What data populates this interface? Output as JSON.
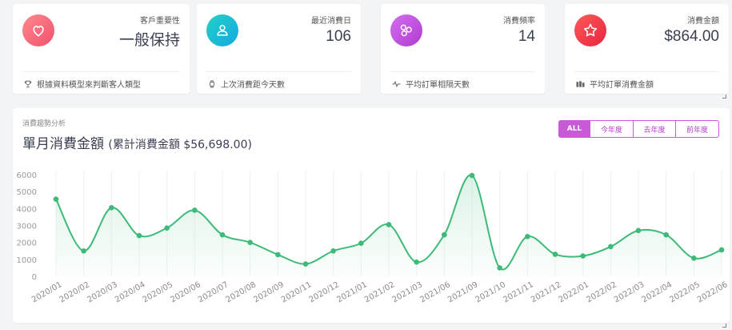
{
  "stats": [
    {
      "label": "客戶重要性",
      "value": "一般保持",
      "footer": "根據資料模型來判斷客人類型",
      "icon": "heart-icon",
      "footer_icon": "trophy-icon",
      "gradient": [
        "#ff8a8a",
        "#f0506e"
      ]
    },
    {
      "label": "最近消費日",
      "value": "106",
      "footer": "上次消費距今天數",
      "icon": "user-icon",
      "footer_icon": "watch-icon",
      "gradient": [
        "#1fd2c5",
        "#17a8e3"
      ]
    },
    {
      "label": "消費頻率",
      "value": "14",
      "footer": "平均訂單相隔天數",
      "icon": "molecule-icon",
      "footer_icon": "pulse-icon",
      "gradient": [
        "#d36ef0",
        "#b03ccf"
      ]
    },
    {
      "label": "消費金額",
      "value": "$864.00",
      "footer": "平均訂單消費金額",
      "icon": "star-icon",
      "footer_icon": "money-icon",
      "gradient": [
        "#ff5a5a",
        "#e8243f"
      ]
    }
  ],
  "chart_section": {
    "subtitle": "消費趨勢分析",
    "title": "單月消費金額",
    "total": "(累計消費金額 $56,698.00)"
  },
  "filters": [
    {
      "label": "ALL",
      "active": true
    },
    {
      "label": "今年度",
      "active": false
    },
    {
      "label": "去年度",
      "active": false
    },
    {
      "label": "前年度",
      "active": false
    }
  ],
  "colors": {
    "line": "#3dba78",
    "area": "#e9f8ef",
    "accent": "#c85ad8"
  },
  "chart_data": {
    "type": "line",
    "x": [
      "2020/01",
      "2020/02",
      "2020/03",
      "2020/04",
      "2020/05",
      "2020/06",
      "2020/07",
      "2020/08",
      "2020/09",
      "2020/11",
      "2020/12",
      "2021/01",
      "2021/02",
      "2021/03",
      "2021/06",
      "2021/09",
      "2021/10",
      "2021/11",
      "2021/12",
      "2022/01",
      "2022/02",
      "2022/03",
      "2022/04",
      "2022/05",
      "2022/06"
    ],
    "series": [
      {
        "values": [
          4550,
          1500,
          4050,
          2400,
          2850,
          3900,
          2450,
          2000,
          1280,
          730,
          1500,
          1950,
          3050,
          840,
          2450,
          5950,
          500,
          2350,
          1300,
          1200,
          1750,
          2700,
          2450,
          1070,
          1560
        ]
      }
    ],
    "yticks": [
      0,
      1000,
      2000,
      3000,
      4000,
      5000,
      6000
    ],
    "ylim": [
      0,
      6000
    ],
    "grid": true
  }
}
